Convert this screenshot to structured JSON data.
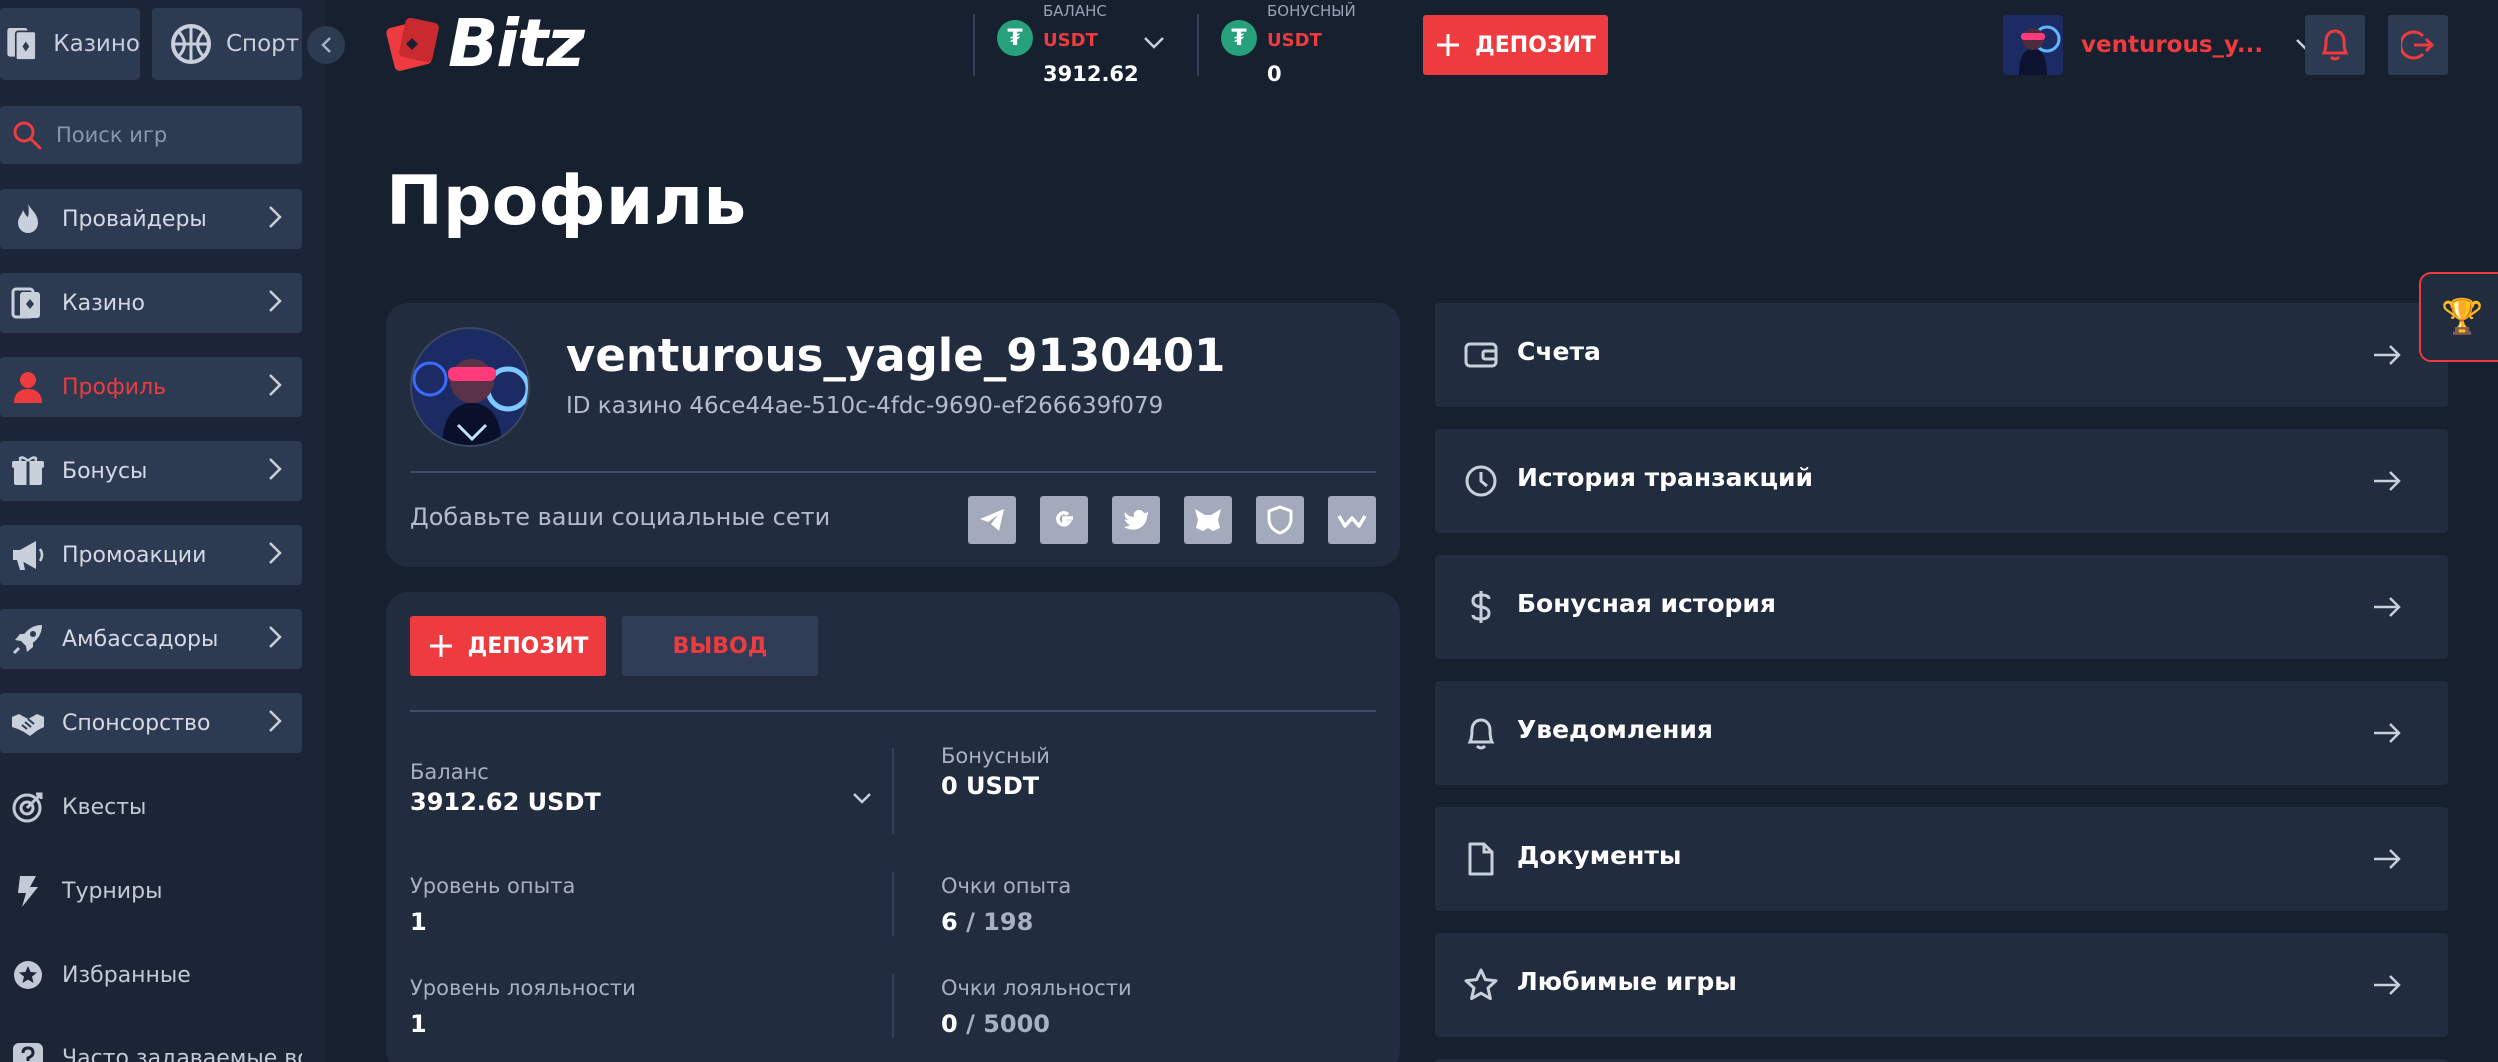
{
  "sidebar": {
    "mode_casino": "Казино",
    "mode_sport": "Спорт",
    "search_placeholder": "Поиск игр",
    "items": [
      {
        "label": "Провайдеры",
        "icon": "flame-icon"
      },
      {
        "label": "Казино",
        "icon": "cards-icon"
      },
      {
        "label": "Профиль",
        "icon": "user-icon",
        "active": true
      },
      {
        "label": "Бонусы",
        "icon": "gift-icon"
      },
      {
        "label": "Промоакции",
        "icon": "megaphone-icon"
      },
      {
        "label": "Амбассадоры",
        "icon": "rocket-icon"
      },
      {
        "label": "Спонсорство",
        "icon": "handshake-icon"
      }
    ],
    "plain_items": [
      {
        "label": "Квесты",
        "icon": "target-icon"
      },
      {
        "label": "Турниры",
        "icon": "lightning-icon"
      },
      {
        "label": "Избранные",
        "icon": "star-circle-icon"
      },
      {
        "label": "Часто задаваемые воп",
        "icon": "question-icon"
      }
    ]
  },
  "header": {
    "logo": "Bitz",
    "balance": {
      "label": "БАЛАНС",
      "currency": "USDT",
      "value": "3912.62"
    },
    "bonus": {
      "label": "БОНУСНЫЙ",
      "currency": "USDT",
      "value": "0"
    },
    "deposit_label": "ДЕПОЗИТ",
    "username": "venturous_y..."
  },
  "main": {
    "title": "Профиль",
    "profile": {
      "username": "venturous_yagle_9130401",
      "casino_id": "ID казино 46ce44ae-510c-4fdc-9690-ef266639f079",
      "social_label": "Добавьте ваши социальные сети"
    },
    "balance_card": {
      "deposit_label": "ДЕПОЗИТ",
      "withdraw_label": "ВЫВОД",
      "balance_label": "Баланс",
      "balance_value": "3912.62 USDT",
      "bonus_label": "Бонусный",
      "bonus_value": "0 USDT",
      "xp_level_label": "Уровень опыта",
      "xp_level_value": "1",
      "xp_points_label": "Очки опыта",
      "xp_points_current": "6",
      "xp_points_total": "/ 198",
      "loyalty_level_label": "Уровень лояльности",
      "loyalty_level_value": "1",
      "loyalty_points_label": "Очки лояльности",
      "loyalty_points_current": "0",
      "loyalty_points_total": "/ 5000"
    },
    "menu": [
      {
        "label": "Счета",
        "icon": "wallet-icon"
      },
      {
        "label": "История транзакций",
        "icon": "clock-icon"
      },
      {
        "label": "Бонусная история",
        "icon": "dollar-icon"
      },
      {
        "label": "Уведомления",
        "icon": "bell-icon"
      },
      {
        "label": "Документы",
        "icon": "document-icon"
      },
      {
        "label": "Любимые игры",
        "icon": "star-icon"
      }
    ]
  },
  "colors": {
    "accent": "#ee3b3f",
    "background": "#17202f",
    "panel": "#212c3f",
    "tether": "#26a17b"
  }
}
